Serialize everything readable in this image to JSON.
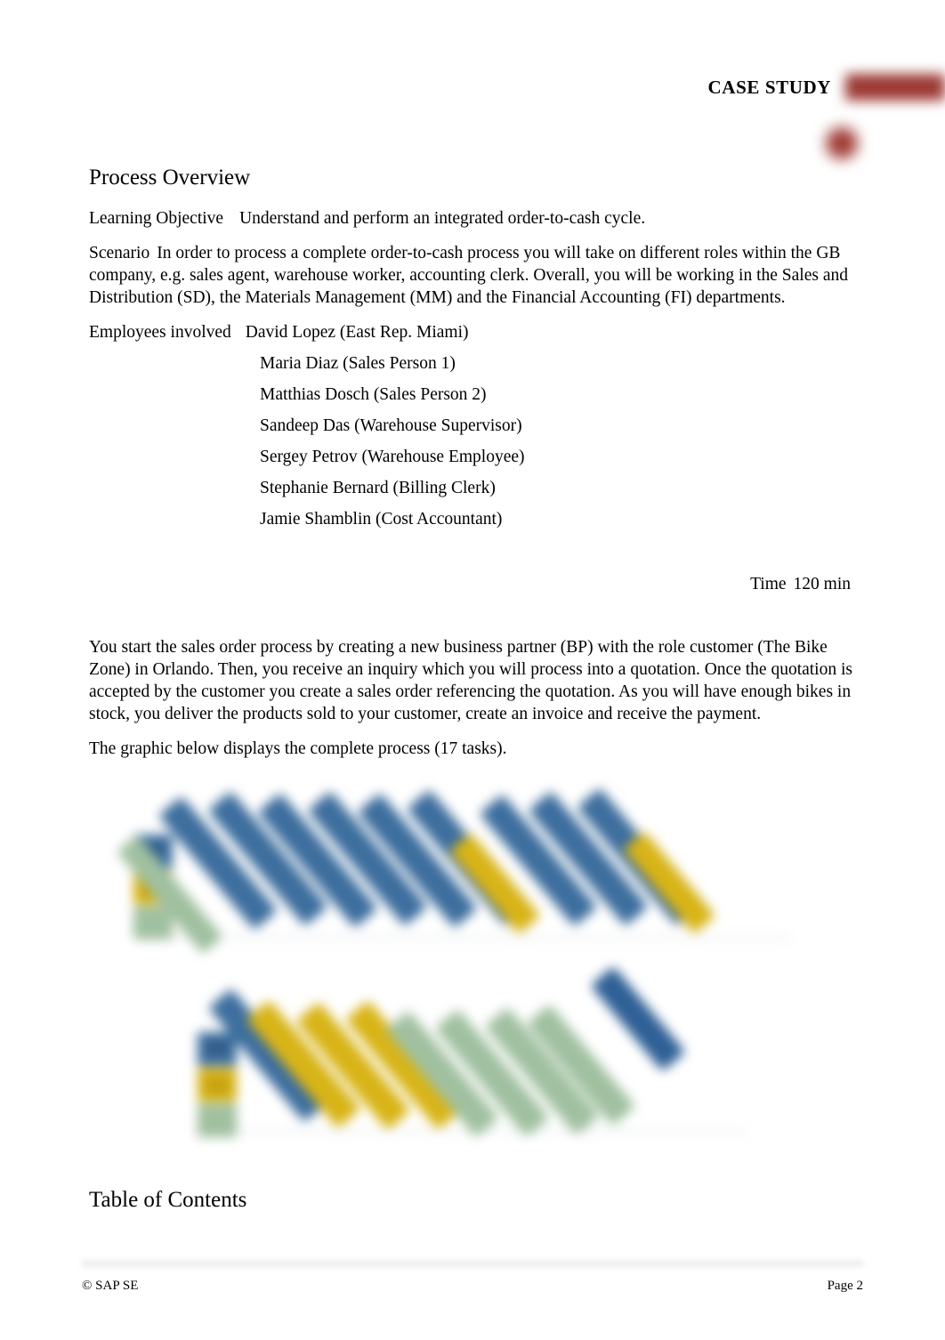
{
  "header": {
    "label": "CASE STUDY",
    "accent_color": "#9c3a34"
  },
  "document": {
    "section_title": "Process Overview",
    "learning_objective": {
      "label": "Learning Objective",
      "value": "Understand and perform an integrated order-to-cash cycle."
    },
    "scenario": {
      "label": "Scenario",
      "value": "In order to process a complete order-to-cash process you will take on different roles within the GB company, e.g. sales agent, warehouse worker, accounting clerk. Overall, you will be working in the Sales and Distribution (SD), the Materials Management (MM) and the Financial Accounting (FI) departments."
    },
    "employees": {
      "label": "Employees involved",
      "list": [
        "David Lopez (East Rep. Miami)",
        "Maria Diaz (Sales Person 1)",
        "Matthias Dosch (Sales Person 2)",
        "Sandeep Das (Warehouse Supervisor)",
        "Sergey Petrov (Warehouse Employee)",
        "Stephanie Bernard (Billing Clerk)",
        "Jamie Shamblin (Cost Accountant)"
      ]
    },
    "time": {
      "label": "Time",
      "value": "120 min"
    },
    "intro_paragraph": "You start the sales order process by creating a new business partner (BP) with the role customer (The Bike Zone) in Orlando. Then, you receive an inquiry which you will process into a quotation. Once the quotation is accepted by the customer you create a sales order referencing the quotation. As you will have enough bikes in stock, you deliver the products sold to your customer, create an invoice and receive the payment.",
    "graphic_caption": "The graphic below displays the complete process (17 tasks).",
    "toc_title": "Table of Contents"
  },
  "diagram": {
    "name": "process-flow-graphic",
    "description": "Blurred order-to-cash process flow graphic",
    "colors": {
      "blue": "#3d6e9e",
      "gold": "#d8b417",
      "green": "#a0c0a0",
      "baseline": "#e9ebee"
    }
  },
  "footer": {
    "copyright": "© SAP SE",
    "page": "Page 2"
  }
}
